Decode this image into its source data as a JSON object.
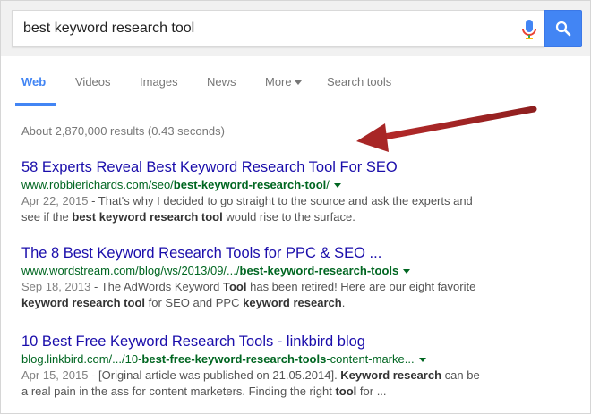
{
  "search": {
    "query": "best keyword research tool"
  },
  "tabs": [
    {
      "label": "Web"
    },
    {
      "label": "Videos"
    },
    {
      "label": "Images"
    },
    {
      "label": "News"
    },
    {
      "label": "More"
    },
    {
      "label": "Search tools"
    }
  ],
  "stats": "About 2,870,000 results (0.43 seconds)",
  "results": [
    {
      "title": "58 Experts Reveal Best Keyword Research Tool For SEO",
      "url_pre": "www.robbierichards.com/seo/",
      "url_bold": "best-keyword-research-tool",
      "url_post": "/",
      "date": "Apr 22, 2015",
      "sep": " - ",
      "s1": "That's why I decided to go straight to the source and ask the experts and see if the ",
      "s1b": "best keyword research tool",
      "s1c": " would rise to the surface."
    },
    {
      "title": "The 8 Best Keyword Research Tools for PPC & SEO ...",
      "url_pre": "www.wordstream.com/blog/ws/2013/09/.../",
      "url_bold": "best-keyword-research-tools",
      "url_post": "",
      "date": "Sep 18, 2013",
      "sep": " - ",
      "s1": "The AdWords Keyword ",
      "s1b": "Tool",
      "s1c": " has been retired! Here are our eight favorite ",
      "s2b": "keyword research tool",
      "s2c": " for SEO and PPC ",
      "s3b": "keyword research",
      "s3c": "."
    },
    {
      "title": "10 Best Free Keyword Research Tools - linkbird blog",
      "url_pre": "blog.linkbird.com/.../10-",
      "url_bold": "best-free-keyword-research-tools",
      "url_post": "-content-marke...",
      "date": "Apr 15, 2015",
      "sep": " - ",
      "s1": "[Original article was published on 21.05.2014]. ",
      "s1b": "Keyword research",
      "s1c": " can be a real pain in the ass for content marketers. Finding the right ",
      "s2b": "tool",
      "s2c": " for ..."
    }
  ],
  "colors": {
    "brand_blue": "#4285f4",
    "link": "#1a0dab",
    "url_green": "#006621",
    "arrow_red": "#c0392b"
  },
  "icons": [
    "microphone-icon",
    "search-icon",
    "caret-down-icon",
    "annotation-arrow"
  ]
}
